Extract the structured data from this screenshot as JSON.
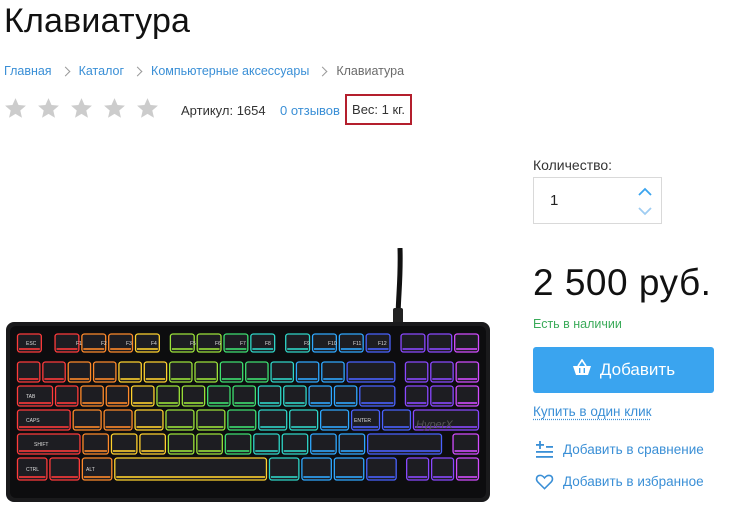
{
  "page": {
    "title": "Клавиатура"
  },
  "breadcrumb": {
    "items": [
      {
        "label": "Главная"
      },
      {
        "label": "Каталог"
      },
      {
        "label": "Компьютерные аксессуары"
      },
      {
        "label": "Клавиатура"
      }
    ]
  },
  "rating": {
    "stars_filled": 0,
    "stars_total": 5,
    "star_color": "#cccccc"
  },
  "product_meta": {
    "sku_label": "Артикул:",
    "sku_value": "1654",
    "reviews_link": "0 отзывов",
    "weight_text": "Вес: 1 кг.",
    "highlight_color": "#b41f2d"
  },
  "quantity": {
    "label": "Количество:",
    "value": "1"
  },
  "price": {
    "text": "2 500 руб."
  },
  "availability": {
    "text": "Есть в наличии",
    "color": "#3bab5a"
  },
  "actions": {
    "add_to_cart": "Добавить",
    "buy_one_click": "Купить в один клик",
    "compare": "Добавить в сравнение",
    "favorite": "Добавить в избранное"
  },
  "colors": {
    "accent": "#3aa4ef",
    "link": "#3a8fd6"
  },
  "icons": {
    "cart": "basket-icon",
    "compare": "compare-list-icon",
    "favorite": "heart-icon",
    "qty_up": "chevron-up-icon",
    "qty_down": "chevron-down-icon"
  },
  "product_image": {
    "logo_text": "HyperX",
    "key_labels": [
      "ESC",
      "F1",
      "F2",
      "F3",
      "F4",
      "F5",
      "F6",
      "F7",
      "F8",
      "F9",
      "F10",
      "F11",
      "F12",
      "TAB",
      "CAPS",
      "SHIFT",
      "CTRL",
      "ALT",
      "ENTER"
    ]
  }
}
